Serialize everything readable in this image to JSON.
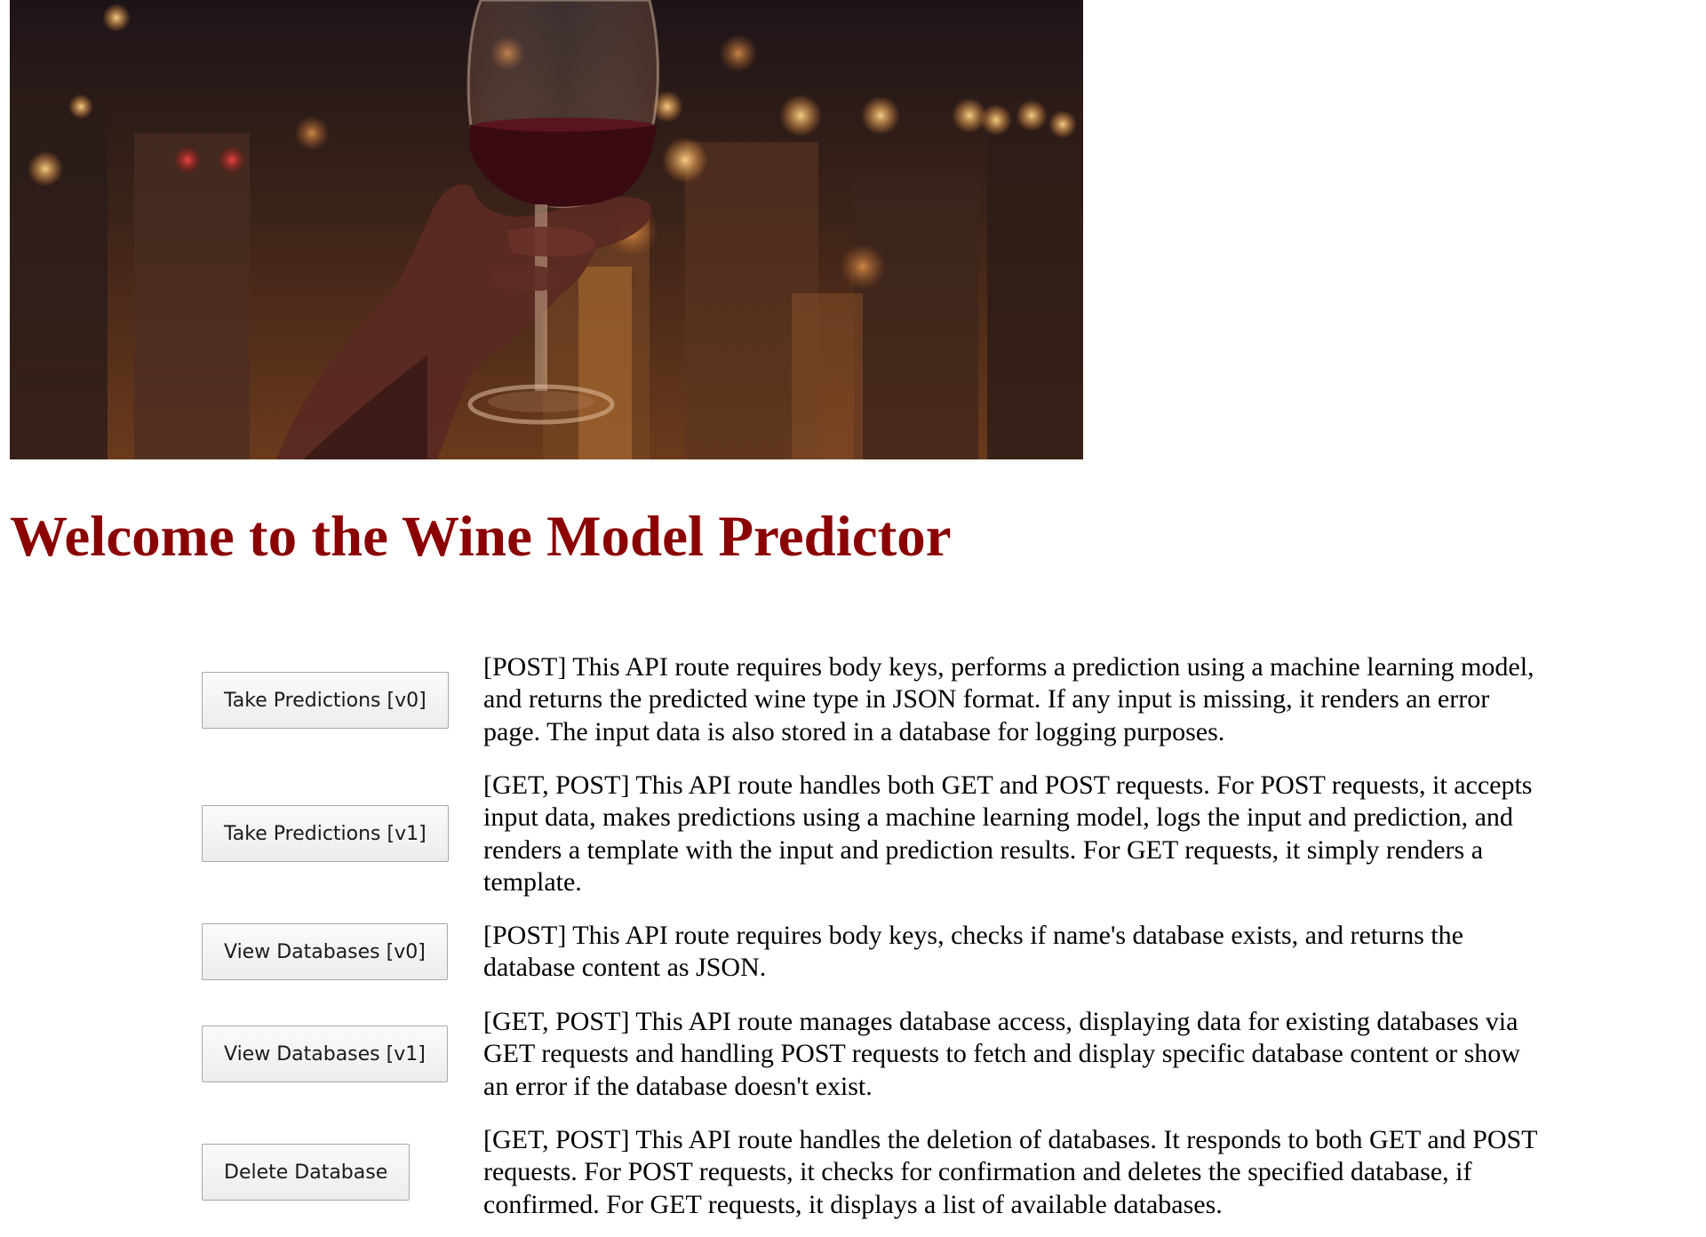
{
  "page": {
    "title": "Welcome to the Wine Model Predictor",
    "title_color": "#8b0000"
  },
  "hero": {
    "description": "Photo of a hand holding a glass of red wine against blurred night city lights"
  },
  "routes": [
    {
      "button_label": "Take Predictions [v0]",
      "description": "[POST] This API route requires body keys, performs a prediction using a machine learning model, and returns the predicted wine type in JSON format. If any input is missing, it renders an error page. The input data is also stored in a database for logging purposes."
    },
    {
      "button_label": "Take Predictions [v1]",
      "description": "[GET, POST] This API route handles both GET and POST requests. For POST requests, it accepts input data, makes predictions using a machine learning model, logs the input and prediction, and renders a template with the input and prediction results. For GET requests, it simply renders a template."
    },
    {
      "button_label": "View Databases [v0]",
      "description": "[POST] This API route requires body keys, checks if name's database exists, and returns the database content as JSON."
    },
    {
      "button_label": "View Databases [v1]",
      "description": "[GET, POST] This API route manages database access, displaying data for existing databases via GET requests and handling POST requests to fetch and display specific database content or show an error if the database doesn't exist."
    },
    {
      "button_label": "Delete Database",
      "description": "[GET, POST] This API route handles the deletion of databases. It responds to both GET and POST requests. For POST requests, it checks for confirmation and deletes the specified database, if confirmed. For GET requests, it displays a list of available databases."
    }
  ]
}
